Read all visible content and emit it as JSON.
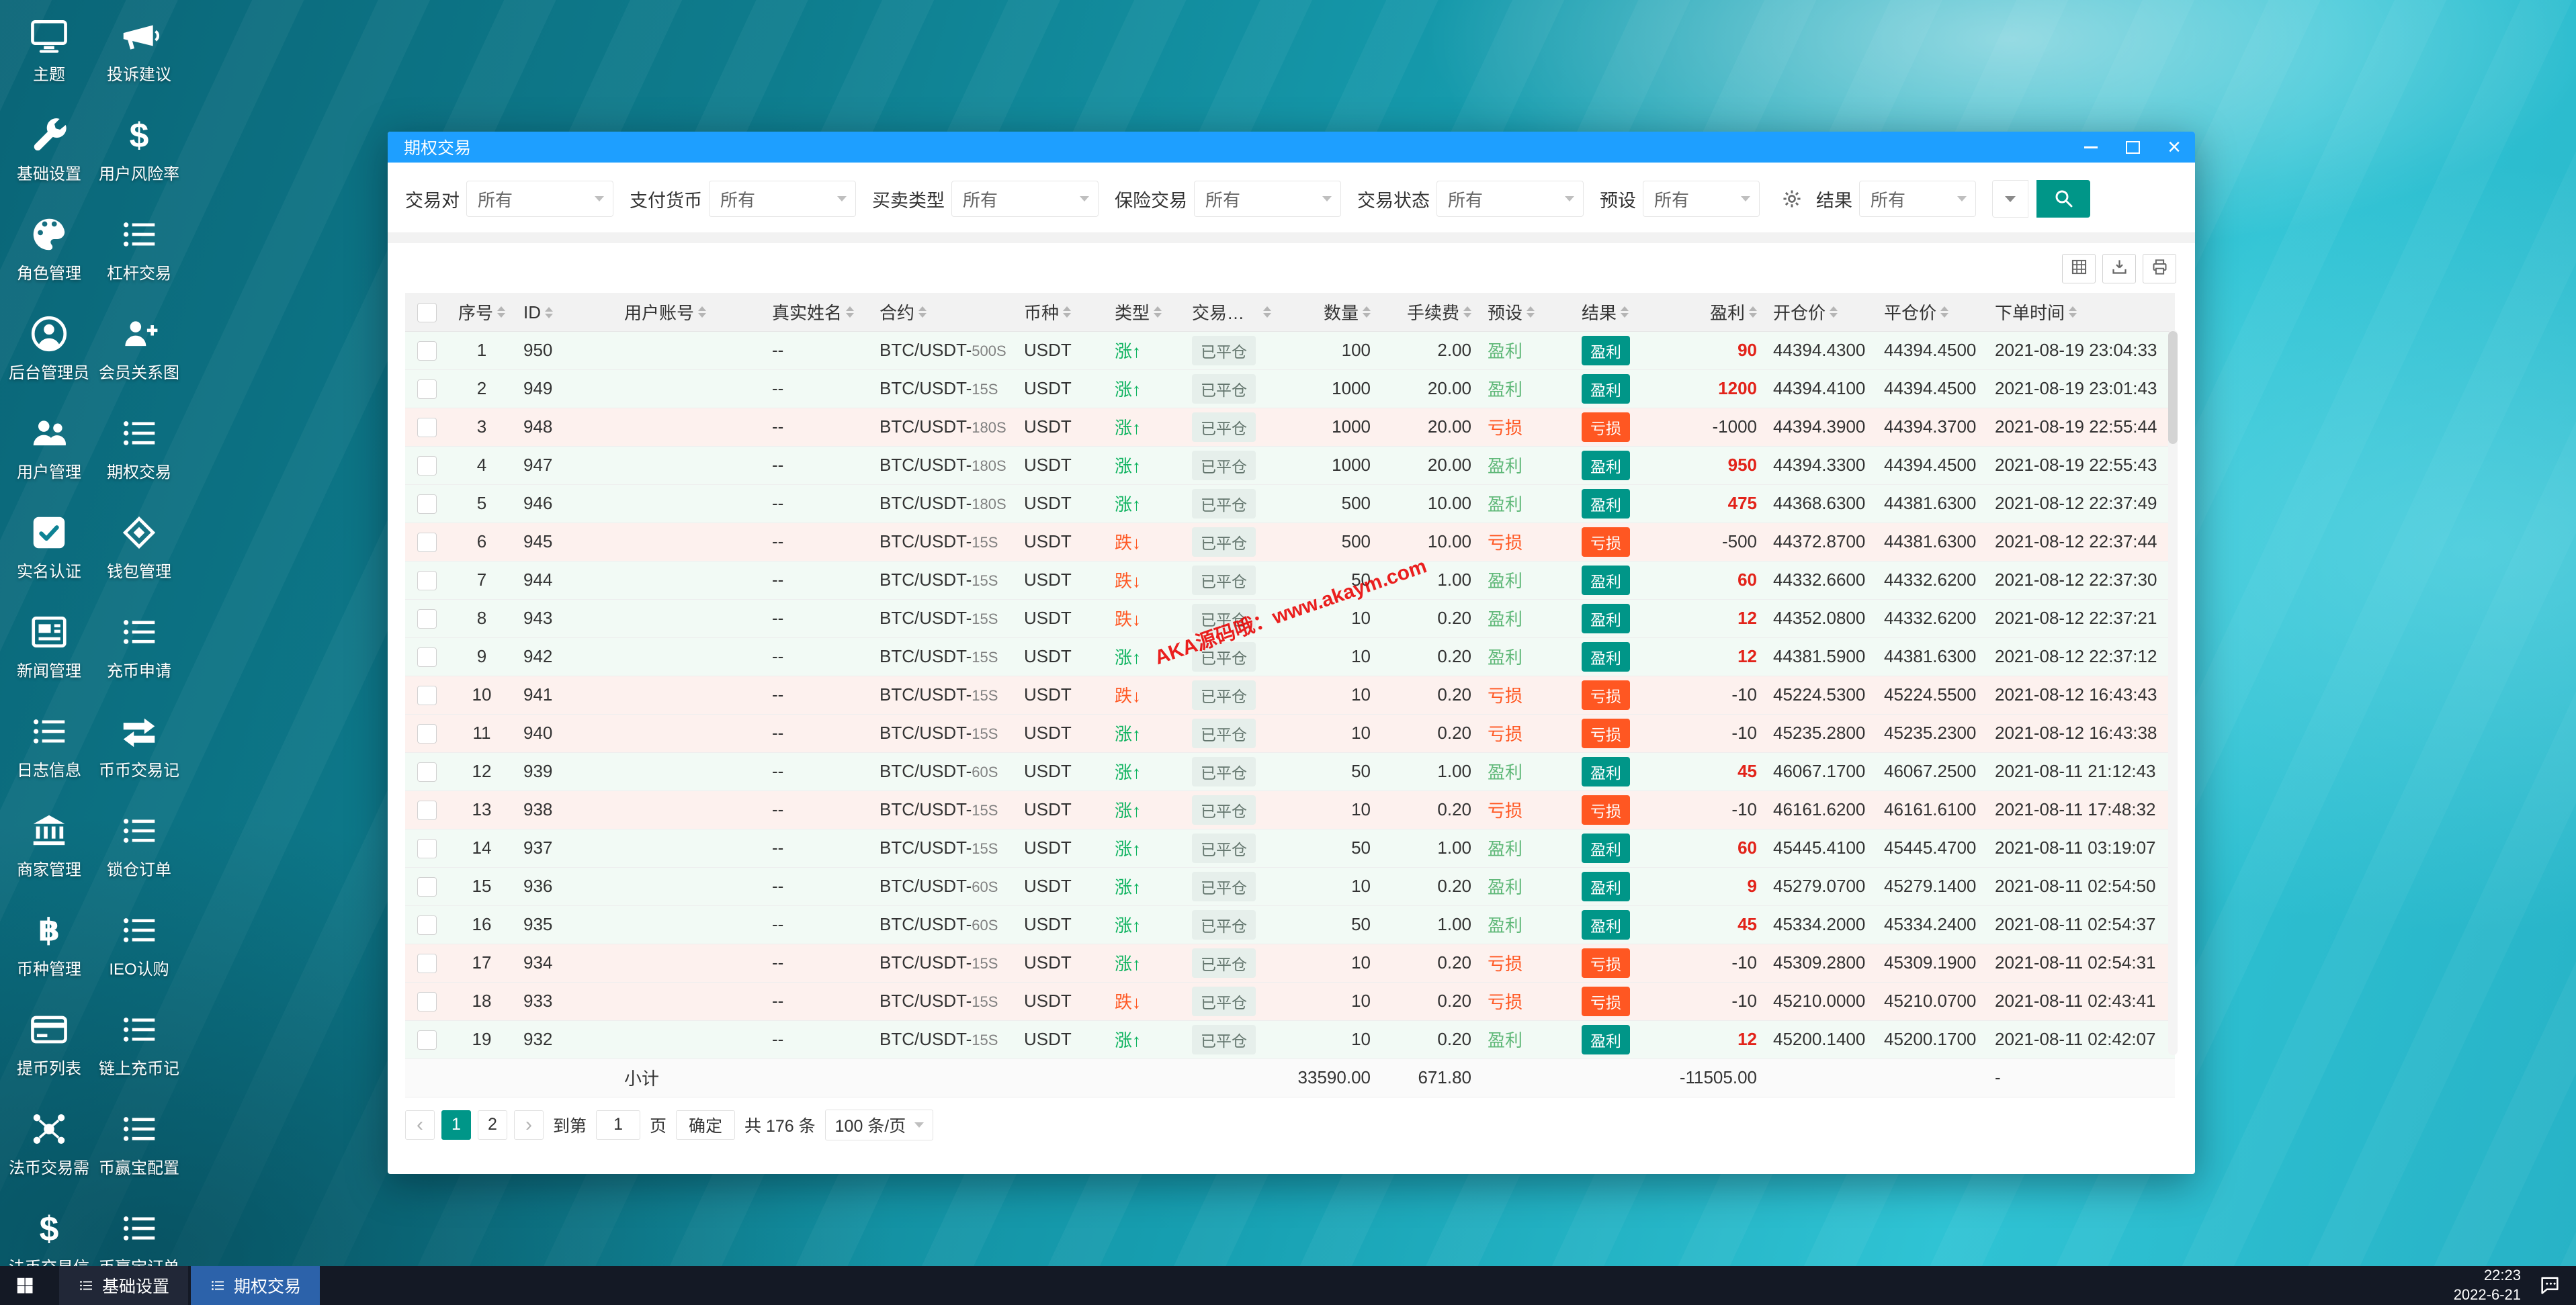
{
  "colors": {
    "titlebar_blue": "#1E9FFF",
    "primary_teal": "#009688",
    "danger_orange": "#FF5722",
    "rise_green": "#0eb35f",
    "preset_green": "#5FB878",
    "profit_red": "#e2231a",
    "taskbar_active_blue": "#2c62aa"
  },
  "desktop": {
    "columns": [
      [
        {
          "label": "主题",
          "icon": "monitor-icon"
        },
        {
          "label": "基础设置",
          "icon": "wrench-icon"
        },
        {
          "label": "角色管理",
          "icon": "palette-icon"
        },
        {
          "label": "后台管理员",
          "icon": "admin-user-icon"
        },
        {
          "label": "用户管理",
          "icon": "users-icon"
        },
        {
          "label": "实名认证",
          "icon": "id-check-icon"
        },
        {
          "label": "新闻管理",
          "icon": "news-icon"
        },
        {
          "label": "日志信息",
          "icon": "list-icon"
        },
        {
          "label": "商家管理",
          "icon": "bank-icon"
        },
        {
          "label": "币种管理",
          "icon": "coin-icon"
        },
        {
          "label": "提币列表",
          "icon": "card-icon"
        },
        {
          "label": "法币交易需",
          "icon": "nodes-icon"
        },
        {
          "label": "法币交易信",
          "icon": "dollar-icon"
        }
      ],
      [
        {
          "label": "投诉建议",
          "icon": "megaphone-icon"
        },
        {
          "label": "用户风险率",
          "icon": "dollar-icon"
        },
        {
          "label": "杠杆交易",
          "icon": "list-icon"
        },
        {
          "label": "会员关系图",
          "icon": "relation-users-icon"
        },
        {
          "label": "期权交易",
          "icon": "list-icon"
        },
        {
          "label": "钱包管理",
          "icon": "wallet-icon"
        },
        {
          "label": "充币申请",
          "icon": "list-icon"
        },
        {
          "label": "币币交易记",
          "icon": "transfer-icon"
        },
        {
          "label": "锁仓订单",
          "icon": "list-icon"
        },
        {
          "label": "IEO认购",
          "icon": "list-icon"
        },
        {
          "label": "链上充币记",
          "icon": "list-icon"
        },
        {
          "label": "币赢宝配置",
          "icon": "list-icon"
        },
        {
          "label": "币赢宝订单",
          "icon": "list-icon"
        }
      ]
    ]
  },
  "window": {
    "title": "期权交易",
    "filters": [
      {
        "key": "trading-pair",
        "label": "交易对",
        "value": "所有"
      },
      {
        "key": "pay-currency",
        "label": "支付货币",
        "value": "所有"
      },
      {
        "key": "trade-type",
        "label": "买卖类型",
        "value": "所有"
      },
      {
        "key": "insurance",
        "label": "保险交易",
        "value": "所有"
      },
      {
        "key": "trade-status",
        "label": "交易状态",
        "value": "所有"
      },
      {
        "key": "preset",
        "label": "预设",
        "value": "所有",
        "narrow": true
      }
    ],
    "result_filter": {
      "key": "result",
      "label": "结果",
      "value": "所有",
      "narrow": true
    },
    "tools": [
      {
        "icon": "columns-icon"
      },
      {
        "icon": "export-icon"
      },
      {
        "icon": "print-icon"
      }
    ]
  },
  "table": {
    "columns": [
      {
        "key": "checkbox",
        "label": "",
        "sortable": false
      },
      {
        "key": "no",
        "label": "序号",
        "sortable": true
      },
      {
        "key": "id",
        "label": "ID",
        "sortable": true
      },
      {
        "key": "account",
        "label": "用户账号",
        "sortable": true
      },
      {
        "key": "name",
        "label": "真实姓名",
        "sortable": true
      },
      {
        "key": "contract",
        "label": "合约",
        "sortable": true
      },
      {
        "key": "currency",
        "label": "币种",
        "sortable": true
      },
      {
        "key": "type",
        "label": "类型",
        "sortable": true
      },
      {
        "key": "status",
        "label": "交易状态",
        "sortable": true
      },
      {
        "key": "amount",
        "label": "数量",
        "sortable": true
      },
      {
        "key": "fee",
        "label": "手续费",
        "sortable": true
      },
      {
        "key": "preset",
        "label": "预设",
        "sortable": true
      },
      {
        "key": "result",
        "label": "结果",
        "sortable": true
      },
      {
        "key": "profit",
        "label": "盈利",
        "sortable": true
      },
      {
        "key": "open",
        "label": "开仓价",
        "sortable": true
      },
      {
        "key": "close",
        "label": "平仓价",
        "sortable": true
      },
      {
        "key": "time",
        "label": "下单时间",
        "sortable": true
      }
    ],
    "rows": [
      {
        "no": "1",
        "id": "950",
        "account": "",
        "name": "--",
        "contract": "BTC/USDT",
        "period": "500S",
        "currency": "USDT",
        "type": "涨↑",
        "status": "已平仓",
        "amount": "100",
        "fee": "2.00",
        "preset": "盈利",
        "result": "盈利",
        "profit": "90",
        "open": "44394.4300",
        "close": "44394.4500",
        "time": "2021-08-19 23:04:33"
      },
      {
        "no": "2",
        "id": "949",
        "account": "",
        "name": "--",
        "contract": "BTC/USDT",
        "period": "15S",
        "currency": "USDT",
        "type": "涨↑",
        "status": "已平仓",
        "amount": "1000",
        "fee": "20.00",
        "preset": "盈利",
        "result": "盈利",
        "profit": "1200",
        "open": "44394.4100",
        "close": "44394.4500",
        "time": "2021-08-19 23:01:43"
      },
      {
        "no": "3",
        "id": "948",
        "account": "",
        "name": "--",
        "contract": "BTC/USDT",
        "period": "180S",
        "currency": "USDT",
        "type": "涨↑",
        "status": "已平仓",
        "amount": "1000",
        "fee": "20.00",
        "preset": "亏损",
        "result": "亏损",
        "profit": "-1000",
        "open": "44394.3900",
        "close": "44394.3700",
        "time": "2021-08-19 22:55:44"
      },
      {
        "no": "4",
        "id": "947",
        "account": "",
        "name": "--",
        "contract": "BTC/USDT",
        "period": "180S",
        "currency": "USDT",
        "type": "涨↑",
        "status": "已平仓",
        "amount": "1000",
        "fee": "20.00",
        "preset": "盈利",
        "result": "盈利",
        "profit": "950",
        "open": "44394.3300",
        "close": "44394.4500",
        "time": "2021-08-19 22:55:43"
      },
      {
        "no": "5",
        "id": "946",
        "account": "",
        "name": "--",
        "contract": "BTC/USDT",
        "period": "180S",
        "currency": "USDT",
        "type": "涨↑",
        "status": "已平仓",
        "amount": "500",
        "fee": "10.00",
        "preset": "盈利",
        "result": "盈利",
        "profit": "475",
        "open": "44368.6300",
        "close": "44381.6300",
        "time": "2021-08-12 22:37:49"
      },
      {
        "no": "6",
        "id": "945",
        "account": "",
        "name": "--",
        "contract": "BTC/USDT",
        "period": "15S",
        "currency": "USDT",
        "type": "跌↓",
        "status": "已平仓",
        "amount": "500",
        "fee": "10.00",
        "preset": "亏损",
        "result": "亏损",
        "profit": "-500",
        "open": "44372.8700",
        "close": "44381.6300",
        "time": "2021-08-12 22:37:44"
      },
      {
        "no": "7",
        "id": "944",
        "account": "",
        "name": "--",
        "contract": "BTC/USDT",
        "period": "15S",
        "currency": "USDT",
        "type": "跌↓",
        "status": "已平仓",
        "amount": "50",
        "fee": "1.00",
        "preset": "盈利",
        "result": "盈利",
        "profit": "60",
        "open": "44332.6600",
        "close": "44332.6200",
        "time": "2021-08-12 22:37:30"
      },
      {
        "no": "8",
        "id": "943",
        "account": "",
        "name": "--",
        "contract": "BTC/USDT",
        "period": "15S",
        "currency": "USDT",
        "type": "跌↓",
        "status": "已平仓",
        "amount": "10",
        "fee": "0.20",
        "preset": "盈利",
        "result": "盈利",
        "profit": "12",
        "open": "44352.0800",
        "close": "44332.6200",
        "time": "2021-08-12 22:37:21"
      },
      {
        "no": "9",
        "id": "942",
        "account": "",
        "name": "--",
        "contract": "BTC/USDT",
        "period": "15S",
        "currency": "USDT",
        "type": "涨↑",
        "status": "已平仓",
        "amount": "10",
        "fee": "0.20",
        "preset": "盈利",
        "result": "盈利",
        "profit": "12",
        "open": "44381.5900",
        "close": "44381.6300",
        "time": "2021-08-12 22:37:12"
      },
      {
        "no": "10",
        "id": "941",
        "account": "",
        "name": "--",
        "contract": "BTC/USDT",
        "period": "15S",
        "currency": "USDT",
        "type": "跌↓",
        "status": "已平仓",
        "amount": "10",
        "fee": "0.20",
        "preset": "亏损",
        "result": "亏损",
        "profit": "-10",
        "open": "45224.5300",
        "close": "45224.5500",
        "time": "2021-08-12 16:43:43"
      },
      {
        "no": "11",
        "id": "940",
        "account": "",
        "name": "--",
        "contract": "BTC/USDT",
        "period": "15S",
        "currency": "USDT",
        "type": "涨↑",
        "status": "已平仓",
        "amount": "10",
        "fee": "0.20",
        "preset": "亏损",
        "result": "亏损",
        "profit": "-10",
        "open": "45235.2800",
        "close": "45235.2300",
        "time": "2021-08-12 16:43:38"
      },
      {
        "no": "12",
        "id": "939",
        "account": "",
        "name": "--",
        "contract": "BTC/USDT",
        "period": "60S",
        "currency": "USDT",
        "type": "涨↑",
        "status": "已平仓",
        "amount": "50",
        "fee": "1.00",
        "preset": "盈利",
        "result": "盈利",
        "profit": "45",
        "open": "46067.1700",
        "close": "46067.2500",
        "time": "2021-08-11 21:12:43"
      },
      {
        "no": "13",
        "id": "938",
        "account": "",
        "name": "--",
        "contract": "BTC/USDT",
        "period": "15S",
        "currency": "USDT",
        "type": "涨↑",
        "status": "已平仓",
        "amount": "10",
        "fee": "0.20",
        "preset": "亏损",
        "result": "亏损",
        "profit": "-10",
        "open": "46161.6200",
        "close": "46161.6100",
        "time": "2021-08-11 17:48:32"
      },
      {
        "no": "14",
        "id": "937",
        "account": "",
        "name": "--",
        "contract": "BTC/USDT",
        "period": "15S",
        "currency": "USDT",
        "type": "涨↑",
        "status": "已平仓",
        "amount": "50",
        "fee": "1.00",
        "preset": "盈利",
        "result": "盈利",
        "profit": "60",
        "open": "45445.4100",
        "close": "45445.4700",
        "time": "2021-08-11 03:19:07"
      },
      {
        "no": "15",
        "id": "936",
        "account": "",
        "name": "--",
        "contract": "BTC/USDT",
        "period": "60S",
        "currency": "USDT",
        "type": "涨↑",
        "status": "已平仓",
        "amount": "10",
        "fee": "0.20",
        "preset": "盈利",
        "result": "盈利",
        "profit": "9",
        "open": "45279.0700",
        "close": "45279.1400",
        "time": "2021-08-11 02:54:50"
      },
      {
        "no": "16",
        "id": "935",
        "account": "",
        "name": "--",
        "contract": "BTC/USDT",
        "period": "60S",
        "currency": "USDT",
        "type": "涨↑",
        "status": "已平仓",
        "amount": "50",
        "fee": "1.00",
        "preset": "盈利",
        "result": "盈利",
        "profit": "45",
        "open": "45334.2000",
        "close": "45334.2400",
        "time": "2021-08-11 02:54:37"
      },
      {
        "no": "17",
        "id": "934",
        "account": "",
        "name": "--",
        "contract": "BTC/USDT",
        "period": "15S",
        "currency": "USDT",
        "type": "涨↑",
        "status": "已平仓",
        "amount": "10",
        "fee": "0.20",
        "preset": "亏损",
        "result": "亏损",
        "profit": "-10",
        "open": "45309.2800",
        "close": "45309.1900",
        "time": "2021-08-11 02:54:31"
      },
      {
        "no": "18",
        "id": "933",
        "account": "",
        "name": "--",
        "contract": "BTC/USDT",
        "period": "15S",
        "currency": "USDT",
        "type": "跌↓",
        "status": "已平仓",
        "amount": "10",
        "fee": "0.20",
        "preset": "亏损",
        "result": "亏损",
        "profit": "-10",
        "open": "45210.0000",
        "close": "45210.0700",
        "time": "2021-08-11 02:43:41"
      },
      {
        "no": "19",
        "id": "932",
        "account": "",
        "name": "--",
        "contract": "BTC/USDT",
        "period": "15S",
        "currency": "USDT",
        "type": "涨↑",
        "status": "已平仓",
        "amount": "10",
        "fee": "0.20",
        "preset": "盈利",
        "result": "盈利",
        "profit": "12",
        "open": "45200.1400",
        "close": "45200.1700",
        "time": "2021-08-11 02:42:07"
      }
    ],
    "subtotal": {
      "label": "小计",
      "amount": "33590.00",
      "fee": "671.80",
      "profit": "-11505.00",
      "time": "-"
    }
  },
  "watermark": "AKA源码哦：www.akaym.com",
  "pagination": {
    "pages": [
      "1",
      "2"
    ],
    "active": "1",
    "goto_label": "到第",
    "page_input": "1",
    "page_unit": "页",
    "confirm_label": "确定",
    "total_label": "共 176 条",
    "page_size": "100 条/页"
  },
  "taskbar": {
    "items": [
      {
        "label": "基础设置",
        "active": false
      },
      {
        "label": "期权交易",
        "active": true
      }
    ],
    "clock_time": "22:23",
    "clock_date": "2022-6-21"
  }
}
